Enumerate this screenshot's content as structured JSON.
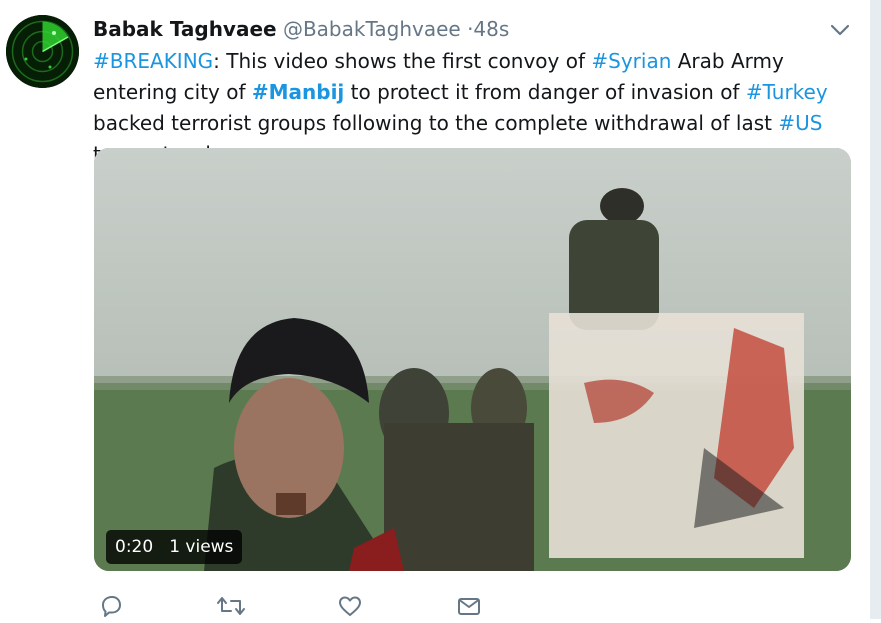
{
  "tweet": {
    "author_name": "Babak Taghvaee",
    "author_handle": "@BabakTaghvaee",
    "separator": "·",
    "timestamp": "48s",
    "text_segments": [
      {
        "text": "#BREAKING",
        "type": "hashtag"
      },
      {
        "text": ": This video shows the first convoy of ",
        "type": "text"
      },
      {
        "text": "#Syrian",
        "type": "hashtag"
      },
      {
        "text": " Arab Army entering city of ",
        "type": "text"
      },
      {
        "text": "#Manbij",
        "type": "hashtag-bold"
      },
      {
        "text": " to protect it from danger of invasion of ",
        "type": "text"
      },
      {
        "text": "#Turkey",
        "type": "hashtag"
      },
      {
        "text": " backed terrorist groups following to the complete withdrawal of last ",
        "type": "text"
      },
      {
        "text": "#US",
        "type": "hashtag"
      },
      {
        "text": " troops two hours ago.",
        "type": "text"
      }
    ]
  },
  "media": {
    "duration": "0:20",
    "views": "1 views"
  },
  "icons": {
    "avatar": "radar-avatar",
    "menu": "chevron-down-icon",
    "reply": "reply-icon",
    "retweet": "retweet-icon",
    "like": "heart-icon",
    "message": "envelope-icon"
  },
  "colors": {
    "link": "#1b95e0",
    "text": "#14171a",
    "secondary": "#657786",
    "avatar_green": "#2fd12f"
  }
}
